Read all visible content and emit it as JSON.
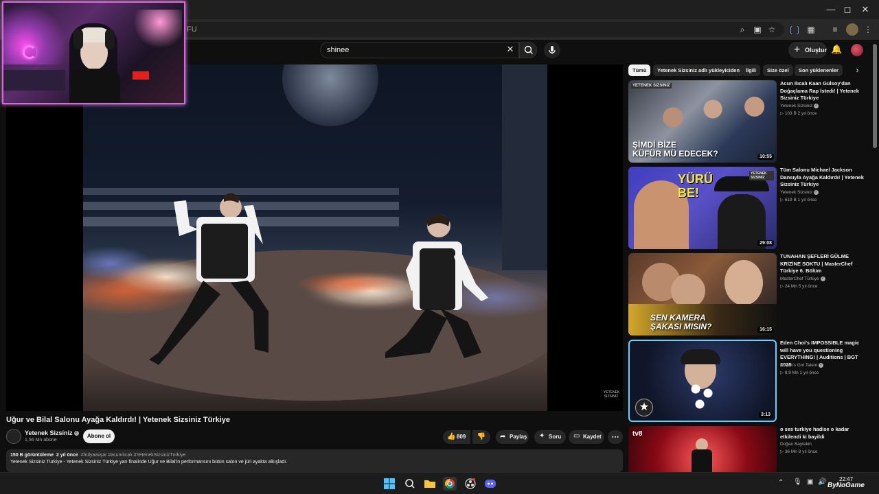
{
  "browser": {
    "url_text": "FU",
    "window_controls": [
      "minimize-icon",
      "maximize-icon",
      "close-icon"
    ]
  },
  "header": {
    "search_value": "shinee",
    "create_label": "Oluştur"
  },
  "video": {
    "title": "Uğur ve Bilal Salonu Ayağa Kaldırdı! | Yetenek Sizsiniz Türkiye",
    "channel": "Yetenek Sizsiniz",
    "subscribers": "1,56 Mn abone",
    "subscribe_label": "Abone ol",
    "likes": "809",
    "share_label": "Paylaş",
    "ask_label": "Soru",
    "save_label": "Kaydet",
    "views": "150 B görüntüleme",
    "age": "2 yıl önce",
    "hashtags": "#hülyaavşar #acunılıcalı #YetenekSizsinizTürkiye",
    "description": "Yetenek Sizsiniz Türkiye -  Yetenek Sizsiniz Türkiye yarı finalinde Uğur ve Bilal'in performansını bütün salon ve jüri ayakta alkışladı.",
    "watermark": "YETENEK SIZSINIZ"
  },
  "chips": [
    "Tümü",
    "Yetenek Sizsiniz adlı yükleyiciden",
    "İlgili",
    "Size özel",
    "Son yüklenenler"
  ],
  "recommendations": [
    {
      "title": "Acun Ilıcalı Kaan Gülsoy'dan Doğaçlama Rap İstedi! | Yetenek Sizsiniz Türkiye",
      "channel": "Yetenek Sizsiniz",
      "meta": "103 B   2 yıl önce",
      "duration": "10:55",
      "overlay": "ŞİMDİ BİZE\nKÜFÜR MÜ EDECEK?",
      "badge": "YETENEK SIZSINIZ"
    },
    {
      "title": "Tüm Salonu Michael Jackson Dansıyla Ayağa Kaldırdı! | Yetenek Sizsiniz Türkiye",
      "channel": "Yetenek Sizsiniz",
      "meta": "619 B   1 yıl önce",
      "duration": "29:08",
      "overlay": "YÜRÜ\nBE!",
      "badge": "YETENEK SIZSINIZ"
    },
    {
      "title": "TUNAHAN ŞEFLERİ GÜLME KRİZİNE SOKTU | MasterChef Türkiye 6. Bölüm",
      "channel": "MasterChef Türkiye",
      "meta": "24 Mn   5 yıl önce",
      "duration": "16:15",
      "overlay": "SEN KAMERA\nŞAKASI MISIN?",
      "badge": ""
    },
    {
      "title": "Eden Choi's IMPOSSIBLE magic will have you questioning EVERYTHING! | Auditions | BGT 2025",
      "channel": "Britain's Got Talent",
      "meta": "8,9 Mn   1 yıl önce",
      "duration": "3:13",
      "overlay": "",
      "badge": ""
    },
    {
      "title": "o ses turkiye  hadise o kadar etkilendi ki bayildi",
      "channel": "Doğan Baytekin",
      "meta": "36 Mn   8 yıl önce",
      "duration": "",
      "overlay": "",
      "badge": "tv8"
    }
  ],
  "taskbar": {
    "time": "22:47",
    "watermark": "ByNoGame"
  }
}
